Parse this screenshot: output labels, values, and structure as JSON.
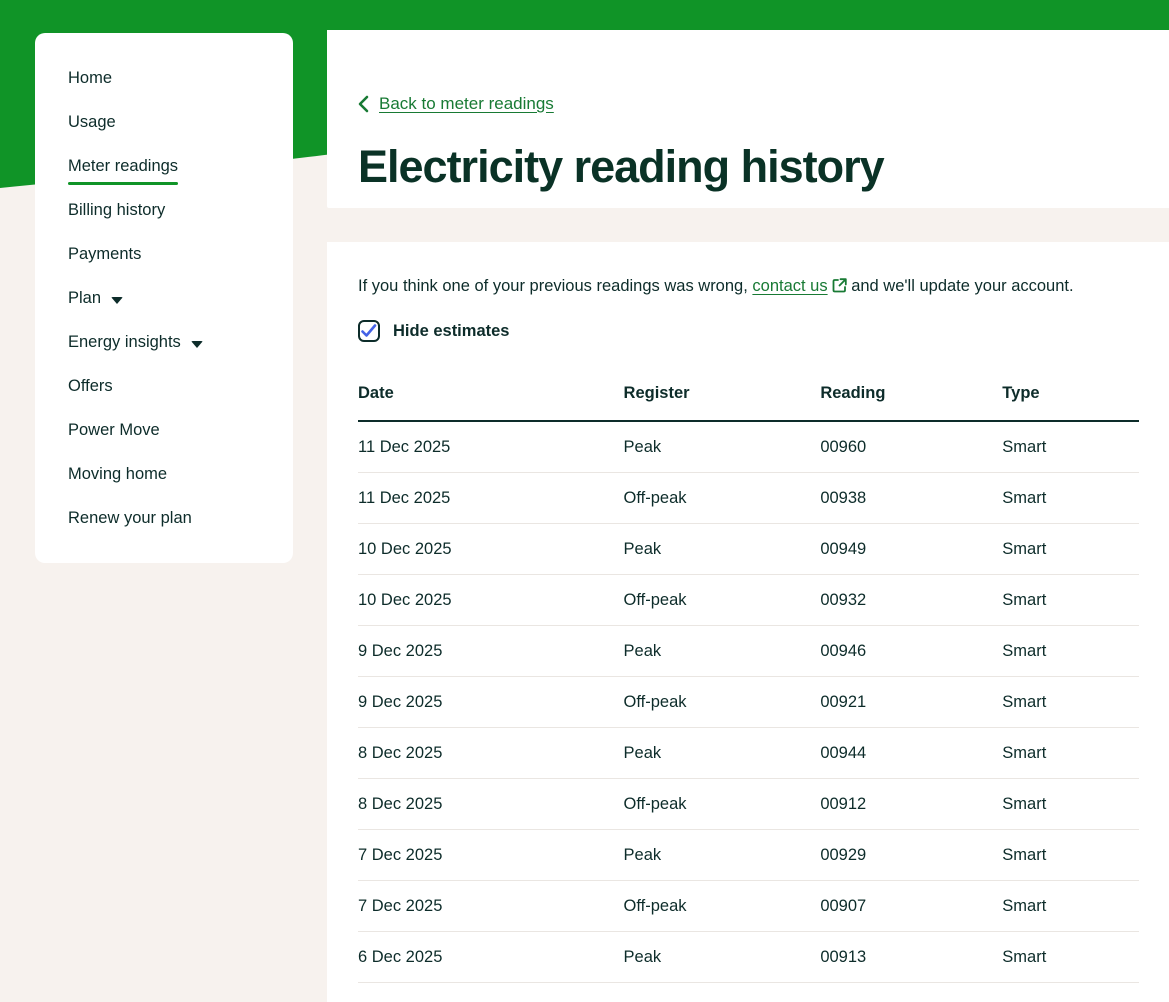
{
  "colors": {
    "brand_green": "#109427",
    "link_green": "#187a34",
    "text_dark": "#0d2c2a",
    "title_dark": "#0a3226",
    "page_beige": "#f7f2ee",
    "checkbox_blue": "#4462e6",
    "row_divider": "#eae6e2"
  },
  "icons": [
    "chevron-left-icon",
    "external-link-icon",
    "checkmark-icon",
    "chevron-down-icon"
  ],
  "sidebar": {
    "items": [
      {
        "id": "home",
        "label": "Home",
        "active": false,
        "has_dropdown": false
      },
      {
        "id": "usage",
        "label": "Usage",
        "active": false,
        "has_dropdown": false
      },
      {
        "id": "meter-readings",
        "label": "Meter readings",
        "active": true,
        "has_dropdown": false
      },
      {
        "id": "billing-history",
        "label": "Billing history",
        "active": false,
        "has_dropdown": false
      },
      {
        "id": "payments",
        "label": "Payments",
        "active": false,
        "has_dropdown": false
      },
      {
        "id": "plan",
        "label": "Plan",
        "active": false,
        "has_dropdown": true
      },
      {
        "id": "energy-insights",
        "label": "Energy insights",
        "active": false,
        "has_dropdown": true
      },
      {
        "id": "offers",
        "label": "Offers",
        "active": false,
        "has_dropdown": false
      },
      {
        "id": "power-move",
        "label": "Power Move",
        "active": false,
        "has_dropdown": false
      },
      {
        "id": "moving-home",
        "label": "Moving home",
        "active": false,
        "has_dropdown": false
      },
      {
        "id": "renew-your-plan",
        "label": "Renew your plan",
        "active": false,
        "has_dropdown": false
      }
    ]
  },
  "header": {
    "back_link": "Back to meter readings",
    "title": "Electricity reading history"
  },
  "content": {
    "notice": {
      "pre": "If you think one of your previous readings was wrong, ",
      "link_label": "contact us",
      "post": " and we'll update your account."
    },
    "checkbox": {
      "label": "Hide estimates",
      "checked": true
    },
    "table": {
      "headers": [
        "Date",
        "Register",
        "Reading",
        "Type"
      ],
      "rows": [
        [
          "11 Dec 2025",
          "Peak",
          "00960",
          "Smart"
        ],
        [
          "11 Dec 2025",
          "Off-peak",
          "00938",
          "Smart"
        ],
        [
          "10 Dec 2025",
          "Peak",
          "00949",
          "Smart"
        ],
        [
          "10 Dec 2025",
          "Off-peak",
          "00932",
          "Smart"
        ],
        [
          "9 Dec 2025",
          "Peak",
          "00946",
          "Smart"
        ],
        [
          "9 Dec 2025",
          "Off-peak",
          "00921",
          "Smart"
        ],
        [
          "8 Dec 2025",
          "Peak",
          "00944",
          "Smart"
        ],
        [
          "8 Dec 2025",
          "Off-peak",
          "00912",
          "Smart"
        ],
        [
          "7 Dec 2025",
          "Peak",
          "00929",
          "Smart"
        ],
        [
          "7 Dec 2025",
          "Off-peak",
          "00907",
          "Smart"
        ],
        [
          "6 Dec 2025",
          "Peak",
          "00913",
          "Smart"
        ]
      ]
    }
  }
}
